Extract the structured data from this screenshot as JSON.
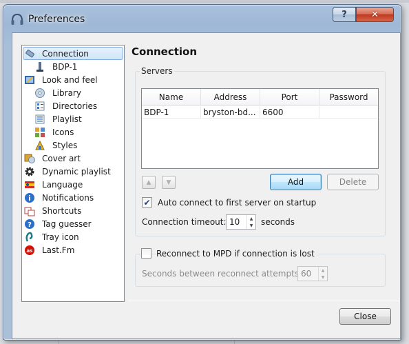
{
  "window": {
    "title": "Preferences",
    "help_glyph": "?",
    "close_glyph": "✕"
  },
  "sidebar": {
    "items": [
      {
        "label": "Connection",
        "icon": "connection-icon",
        "level": 0,
        "selected": true
      },
      {
        "label": "BDP-1",
        "icon": "mpd-server-icon",
        "level": 1
      },
      {
        "label": "Look and feel",
        "icon": "look-and-feel-icon",
        "level": 0
      },
      {
        "label": "Library",
        "icon": "library-icon",
        "level": 1
      },
      {
        "label": "Directories",
        "icon": "directories-icon",
        "level": 1
      },
      {
        "label": "Playlist",
        "icon": "playlist-icon",
        "level": 1
      },
      {
        "label": "Icons",
        "icon": "icons-icon",
        "level": 1
      },
      {
        "label": "Styles",
        "icon": "styles-icon",
        "level": 1
      },
      {
        "label": "Cover art",
        "icon": "cover-art-icon",
        "level": 0
      },
      {
        "label": "Dynamic playlist",
        "icon": "gear-icon",
        "level": 0
      },
      {
        "label": "Language",
        "icon": "language-icon",
        "level": 0
      },
      {
        "label": "Notifications",
        "icon": "info-icon",
        "level": 0
      },
      {
        "label": "Shortcuts",
        "icon": "shortcuts-icon",
        "level": 0
      },
      {
        "label": "Tag guesser",
        "icon": "question-icon",
        "level": 0
      },
      {
        "label": "Tray icon",
        "icon": "tray-icon",
        "level": 0
      },
      {
        "label": "Last.Fm",
        "icon": "lastfm-icon",
        "level": 0
      }
    ]
  },
  "main": {
    "heading": "Connection",
    "servers_group": {
      "title": "Servers",
      "columns": [
        "Name",
        "Address",
        "Port",
        "Password"
      ],
      "rows": [
        {
          "name": "BDP-1",
          "address": "bryston-bd...",
          "port": "6600",
          "password": ""
        }
      ],
      "add_label": "Add",
      "delete_label": "Delete",
      "auto_connect_label": "Auto connect to first server on startup",
      "auto_connect_checked": true,
      "timeout_label": "Connection timeout:",
      "timeout_value": "10",
      "timeout_unit": "seconds"
    },
    "reconnect_group": {
      "label": "Reconnect to MPD if connection is lost",
      "checked": false,
      "interval_label": "Seconds between reconnect attempts:",
      "interval_value": "60"
    }
  },
  "footer": {
    "close_label": "Close"
  },
  "colors": {
    "selection_bg": "#cde6f7",
    "default_button": "#3c7fb1",
    "close_red": "#c0391f"
  }
}
